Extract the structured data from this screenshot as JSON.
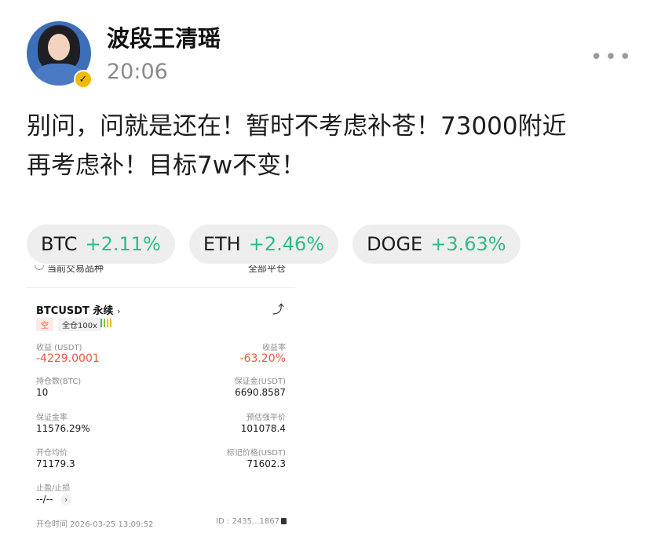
{
  "post": {
    "author": "波段王清瑶",
    "time": "20:06",
    "more_icon": "more-dots-icon",
    "line1": "别问，问就是还在！暂时不考虑补苍！73000附近",
    "line2": "再考虑补！目标7w不变！"
  },
  "tickers": [
    {
      "symbol": "BTC",
      "change": "+2.11%"
    },
    {
      "symbol": "ETH",
      "change": "+2.46%"
    },
    {
      "symbol": "DOGE",
      "change": "+3.63%"
    }
  ],
  "position": {
    "cut_left": "当前交易品种",
    "cut_right": "全部平仓",
    "pair": "BTCUSDT 永续",
    "pair_chevron": "›",
    "side": "空",
    "leverage": "全仓100x",
    "pnl_label": "收益 (USDT)",
    "pnl_value": "-4229.0001",
    "roe_label": "收益率",
    "roe_value": "-63.20%",
    "size_label": "持仓数(BTC)",
    "size_value": "10",
    "margin_label": "保证金(USDT)",
    "margin_value": "6690.8587",
    "margin_ratio_label": "保证金率",
    "margin_ratio_value": "11576.29%",
    "liq_label": "预估强平价",
    "liq_value": "101078.4",
    "entry_label": "开仓均价",
    "entry_value": "71179.3",
    "mark_label": "标记价格(USDT)",
    "mark_value": "71602.3",
    "tpsl_label": "止盈/止损",
    "tpsl_value": "--/--",
    "tpsl_chevron": "›",
    "open_time": "开仓时间 2026-03-25 13:09:52",
    "id": "ID : 2435...1867"
  },
  "colors": {
    "positive": "#2ebd85",
    "negative": "#e4593d",
    "verified_badge": "#f0b90b"
  }
}
